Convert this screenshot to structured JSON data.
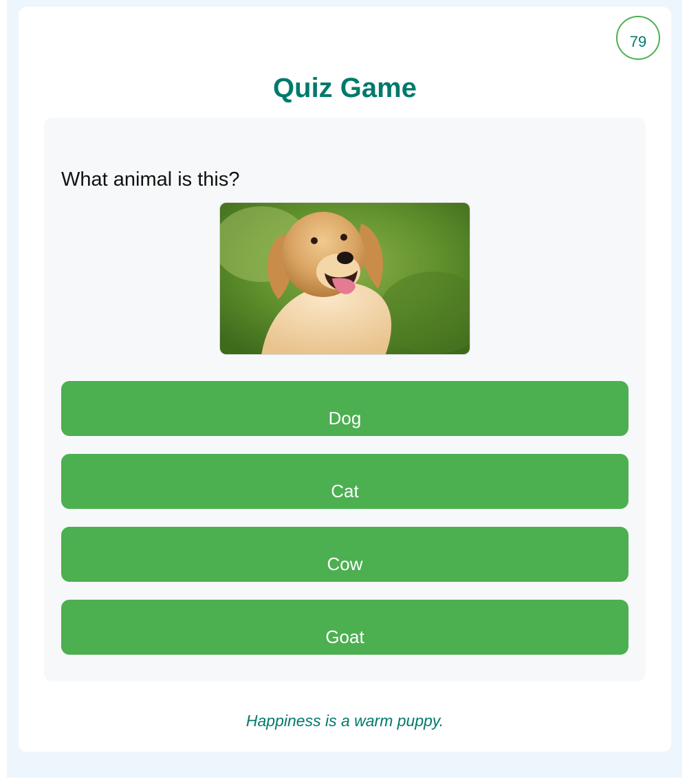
{
  "timer": {
    "value": "79",
    "ring_color": "#4caf50"
  },
  "title": "Quiz Game",
  "question": {
    "text": "What animal is this?",
    "image_icon": "golden-retriever-photo"
  },
  "options": [
    {
      "label": "Dog"
    },
    {
      "label": "Cat"
    },
    {
      "label": "Cow"
    },
    {
      "label": "Goat"
    }
  ],
  "footer": {
    "quote": "Happiness is a warm puppy."
  },
  "colors": {
    "accent": "#4caf50",
    "title": "#00796b",
    "background": "#eef6fd"
  }
}
